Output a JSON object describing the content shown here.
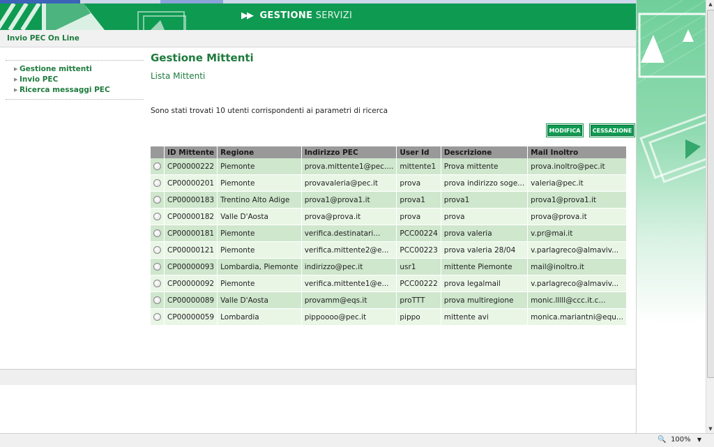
{
  "header": {
    "arrows": "▶▶",
    "title_bold": "GESTIONE",
    "title_light": "SERVIZI"
  },
  "subbar": {
    "app_title": "Invio PEC On Line"
  },
  "nav": {
    "items": [
      {
        "label": "Gestione mittenti"
      },
      {
        "label": "Invio PEC"
      },
      {
        "label": "Ricerca messaggi PEC"
      }
    ]
  },
  "main": {
    "title": "Gestione Mittenti",
    "subtitle": "Lista Mittenti",
    "info": "Sono stati trovati 10 utenti corrispondenti ai parametri di ricerca",
    "buttons": {
      "modify": "MODIFICA",
      "cease": "CESSAZIONE"
    }
  },
  "table": {
    "headers": [
      "ID Mittente",
      "Regione",
      "Indirizzo PEC",
      "User Id",
      "Descrizione",
      "Mail Inoltro"
    ],
    "rows": [
      [
        "CP00000222",
        "Piemonte",
        "prova.mittente1@pec....",
        "mittente1",
        "Prova mittente",
        "prova.inoltro@pec.it"
      ],
      [
        "CP00000201",
        "Piemonte",
        "provavaleria@pec.it",
        "prova",
        "prova indirizzo soge...",
        "valeria@pec.it"
      ],
      [
        "CP00000183",
        "Trentino Alto Adige",
        "prova1@prova1.it",
        "prova1",
        "prova1",
        "prova1@prova1.it"
      ],
      [
        "CP00000182",
        "Valle D'Aosta",
        "prova@prova.it",
        "prova",
        "prova",
        "prova@prova.it"
      ],
      [
        "CP00000181",
        "Piemonte",
        "verifica.destinatari...",
        "PCC00224",
        "prova valeria",
        "v.pr@mai.it"
      ],
      [
        "CP00000121",
        "Piemonte",
        "verifica.mittente2@e...",
        "PCC00223",
        "prova valeria 28/04",
        "v.parlagreco@almaviv..."
      ],
      [
        "CP00000093",
        "Lombardia, Piemonte",
        "indirizzo@pec.it",
        "usr1",
        "mittente Piemonte",
        "mail@inoltro.it"
      ],
      [
        "CP00000092",
        "Piemonte",
        "verifica.mittente1@e...",
        "PCC00222",
        "prova legalmail",
        "v.parlagreco@almaviv..."
      ],
      [
        "CP00000089",
        "Valle D'Aosta",
        "provamm@eqs.it",
        "proTTT",
        "prova multiregione",
        "monic.lllll@ccc.it.c..."
      ],
      [
        "CP00000059",
        "Lombardia",
        "pippoooo@pec.it",
        "pippo",
        "mittente avi",
        "monica.mariantni@equ..."
      ]
    ]
  },
  "statusbar": {
    "zoom": "100%"
  },
  "colors": {
    "brand_green": "#0f9a52",
    "text_green": "#1e7b3e",
    "row_odd": "#cfe7cd",
    "row_even": "#e9f6e6",
    "header_gray": "#999999"
  }
}
